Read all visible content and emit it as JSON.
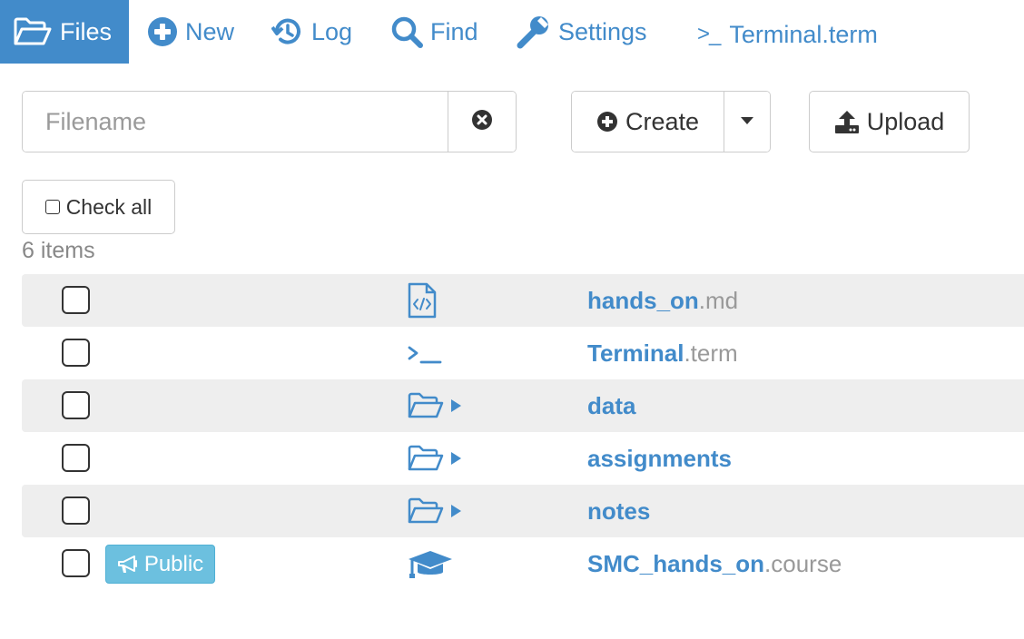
{
  "nav": {
    "files": "Files",
    "new": "New",
    "log": "Log",
    "find": "Find",
    "settings": "Settings",
    "terminal_prompt": ">_",
    "terminal": "Terminal.term"
  },
  "search": {
    "placeholder": "Filename",
    "value": ""
  },
  "actions": {
    "create": "Create",
    "upload": "Upload",
    "check_all": "Check all"
  },
  "listing": {
    "count": "6 items",
    "items": [
      {
        "base": "hands_on",
        "ext": ".md",
        "icon": "file-code-icon"
      },
      {
        "base": "Terminal",
        "ext": ".term",
        "icon": "terminal-icon"
      },
      {
        "base": "data",
        "ext": "",
        "icon": "folder-open-icon"
      },
      {
        "base": "assignments",
        "ext": "",
        "icon": "folder-open-icon"
      },
      {
        "base": "notes",
        "ext": "",
        "icon": "folder-open-icon"
      },
      {
        "base": "SMC_hands_on",
        "ext": ".course",
        "icon": "graduation-cap-icon",
        "badge": "Public"
      }
    ]
  },
  "colors": {
    "accent": "#428bca",
    "badge": "#6cc0df",
    "stripe": "#eeeeee",
    "muted": "#999999"
  }
}
